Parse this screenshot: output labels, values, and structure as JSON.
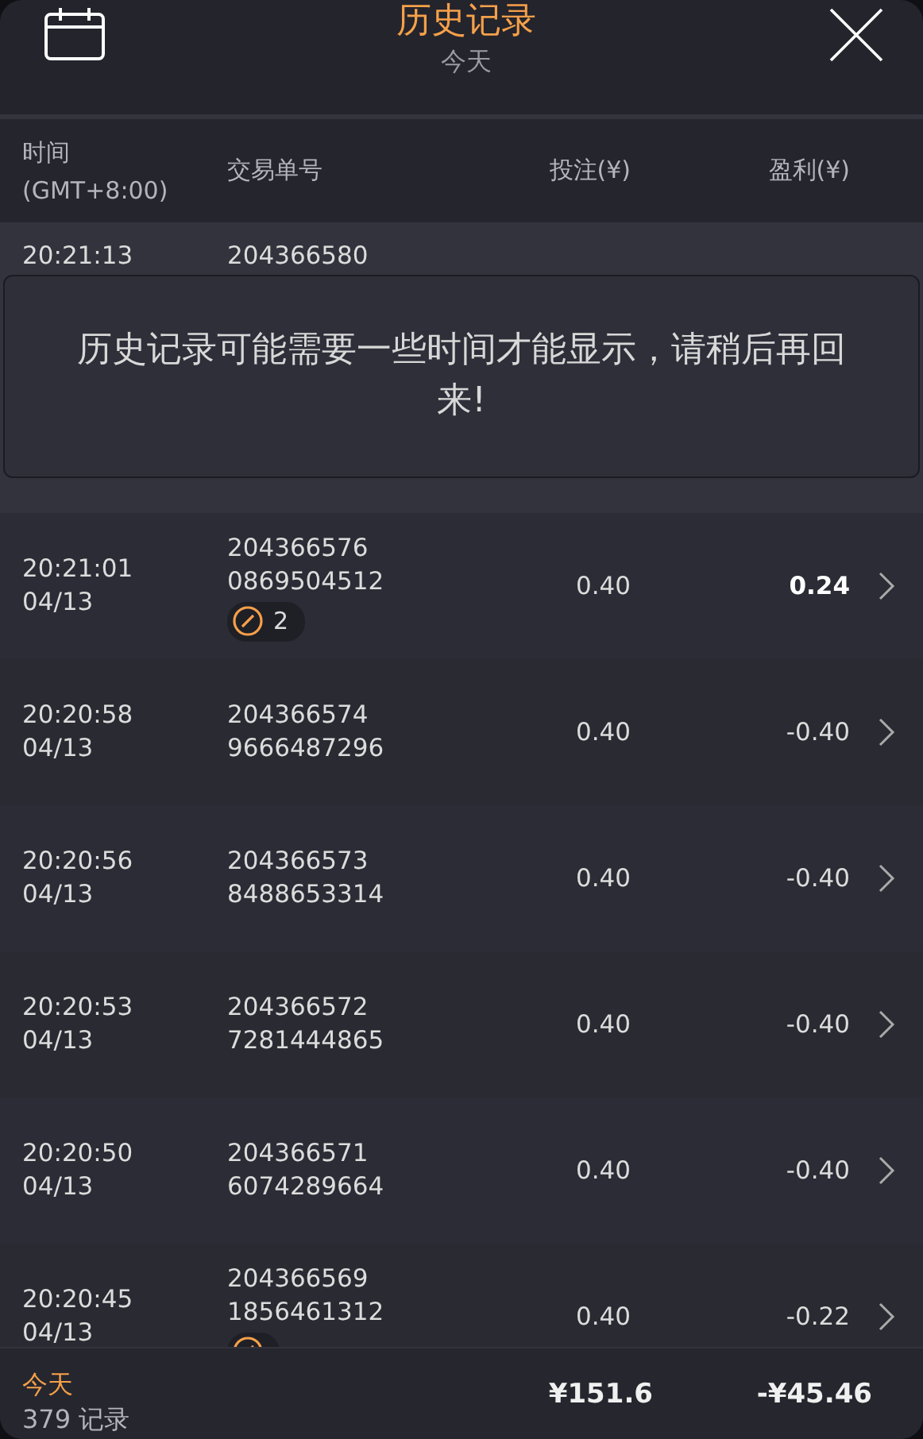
{
  "header": {
    "title": "历史记录",
    "subtitle": "今天"
  },
  "columns": [
    {
      "label": "时间",
      "sublabel": "(GMT+8:00)"
    },
    {
      "label": "交易单号"
    },
    {
      "label": "投注(¥)"
    },
    {
      "label": "盈利(¥)"
    }
  ],
  "rows": [
    {
      "kind": "partial",
      "time": "20:21:13",
      "order": "204366580"
    },
    {
      "kind": "full",
      "time": "20:21:01",
      "date": "04/13",
      "order": "204366576",
      "order_2": "0869504512",
      "badge": {
        "count": "2"
      },
      "stake": "0.40",
      "profit": "0.24",
      "win": true
    },
    {
      "kind": "full",
      "time": "20:20:58",
      "date": "04/13",
      "order": "204366574",
      "order_2": "9666487296",
      "stake": "0.40",
      "profit": "-0.40",
      "win": false
    },
    {
      "kind": "full",
      "time": "20:20:56",
      "date": "04/13",
      "order": "204366573",
      "order_2": "8488653314",
      "stake": "0.40",
      "profit": "-0.40",
      "win": false
    },
    {
      "kind": "full",
      "time": "20:20:53",
      "date": "04/13",
      "order": "204366572",
      "order_2": "7281444865",
      "stake": "0.40",
      "profit": "-0.40",
      "win": false
    },
    {
      "kind": "full",
      "time": "20:20:50",
      "date": "04/13",
      "order": "204366571",
      "order_2": "6074289664",
      "stake": "0.40",
      "profit": "-0.40",
      "win": false
    },
    {
      "kind": "full",
      "time": "20:20:45",
      "date": "04/13",
      "order": "204366569",
      "order_2": "1856461312",
      "badge": {},
      "stake": "0.40",
      "profit": "-0.22",
      "win": false
    }
  ],
  "toast": {
    "message": "历史记录可能需要一些时间才能显示，请稍后再回来!"
  },
  "footer": {
    "period": "今天",
    "records": "379 记录",
    "total_stake": "¥151.6",
    "total_profit": "-¥45.46"
  }
}
